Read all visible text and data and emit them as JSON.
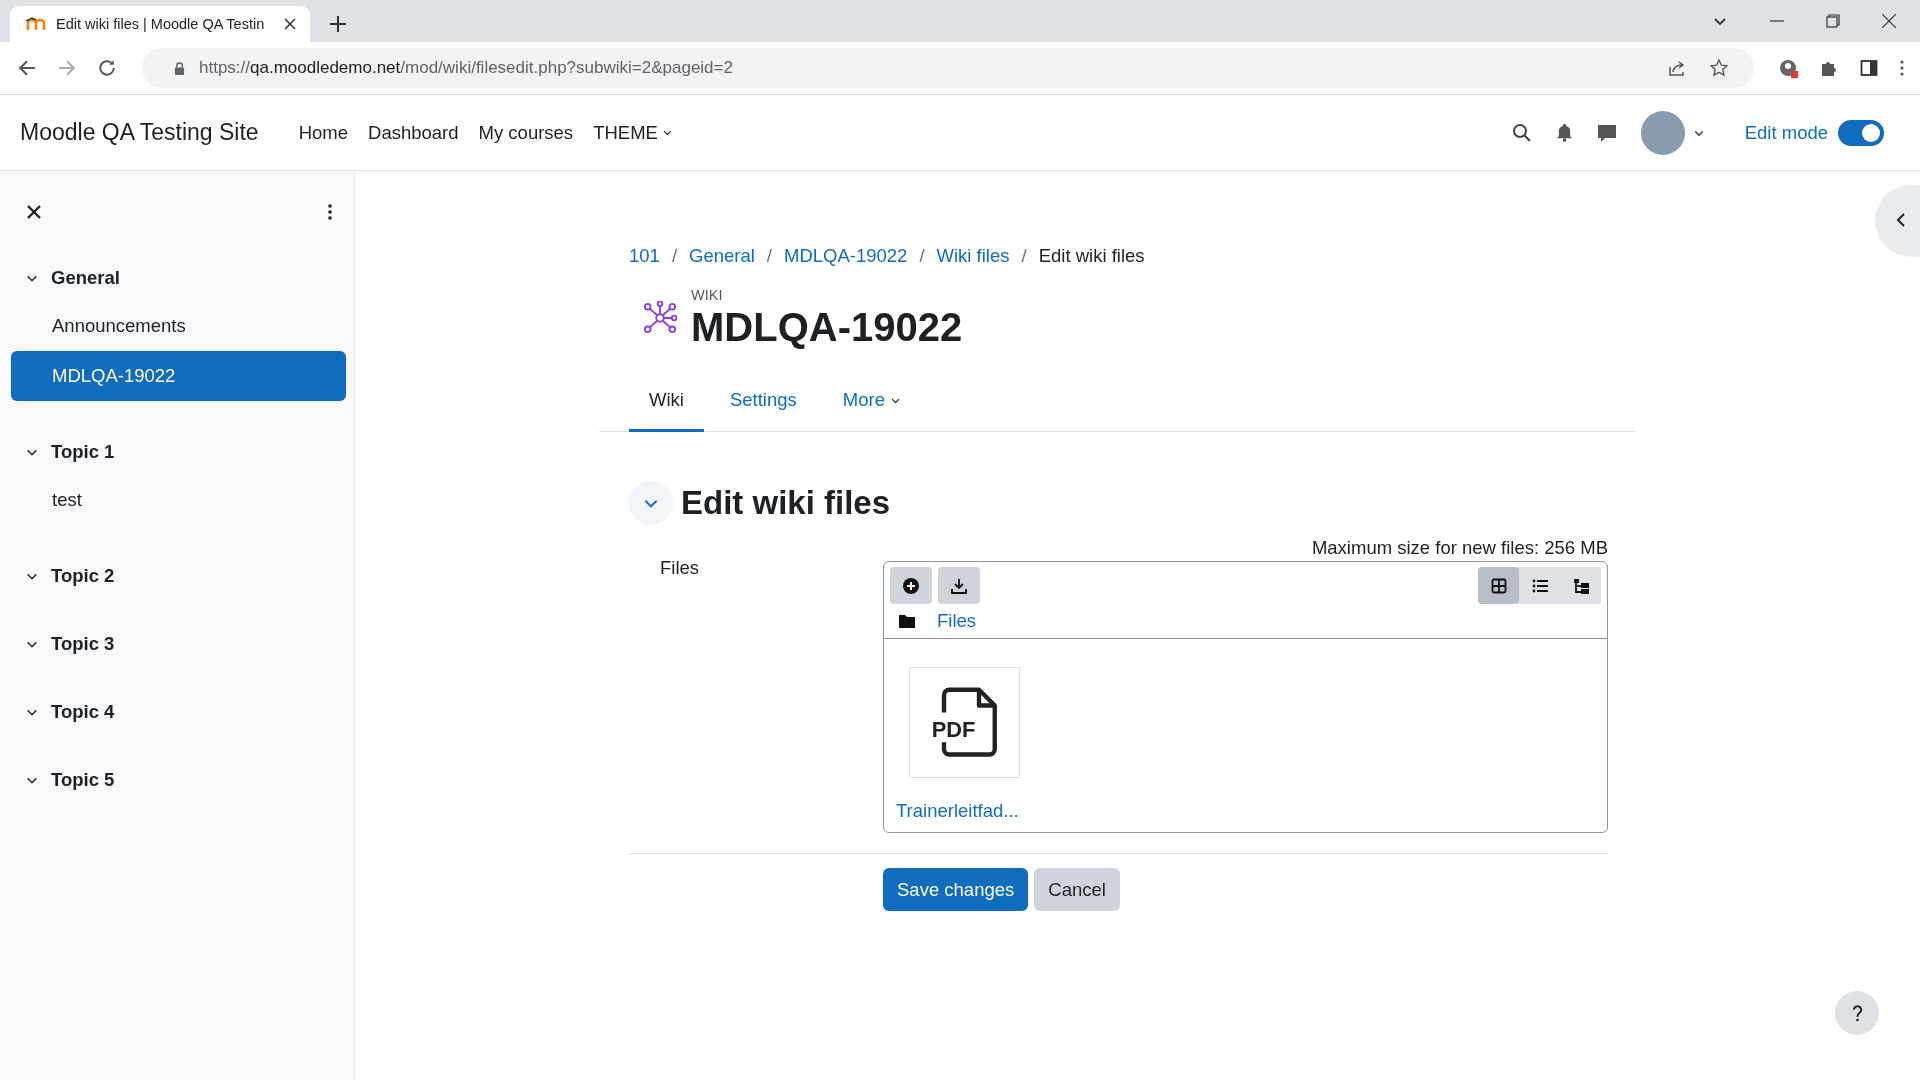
{
  "browser": {
    "tab_title": "Edit wiki files | Moodle QA Testin",
    "url_scheme": "https://",
    "url_host": "qa.moodledemo.net",
    "url_path": "/mod/wiki/filesedit.php?subwiki=2&pageid=2"
  },
  "navbar": {
    "site_name": "Moodle QA Testing Site",
    "links": [
      {
        "label": "Home",
        "dropdown": false
      },
      {
        "label": "Dashboard",
        "dropdown": false
      },
      {
        "label": "My courses",
        "dropdown": false
      },
      {
        "label": "THEME",
        "dropdown": true
      }
    ],
    "edit_mode": {
      "label": "Edit mode",
      "on": true
    }
  },
  "sidebar": {
    "sections": [
      {
        "label": "General",
        "expanded": true,
        "children": [
          {
            "label": "Announcements",
            "selected": false
          },
          {
            "label": "MDLQA-19022",
            "selected": true
          }
        ]
      },
      {
        "label": "Topic 1",
        "expanded": true,
        "children": [
          {
            "label": "test",
            "selected": false
          }
        ]
      },
      {
        "label": "Topic 2",
        "expanded": true
      },
      {
        "label": "Topic 3",
        "expanded": true
      },
      {
        "label": "Topic 4",
        "expanded": true
      },
      {
        "label": "Topic 5",
        "expanded": true
      }
    ]
  },
  "breadcrumb": {
    "separator": "/",
    "items": [
      {
        "label": "101",
        "kind": "link"
      },
      {
        "label": "General",
        "kind": "link"
      },
      {
        "label": "MDLQA-19022",
        "kind": "link"
      },
      {
        "label": "Wiki files",
        "kind": "link"
      },
      {
        "label": "Edit wiki files",
        "kind": "text"
      }
    ]
  },
  "activity": {
    "type_label": "WIKI",
    "title": "MDLQA-19022"
  },
  "tabs": [
    {
      "label": "Wiki",
      "selected": true,
      "dropdown": false
    },
    {
      "label": "Settings",
      "selected": false,
      "dropdown": false
    },
    {
      "label": "More",
      "selected": false,
      "dropdown": true
    }
  ],
  "section": {
    "title": "Edit wiki files",
    "expanded": true
  },
  "form": {
    "field_label": "Files",
    "max_size": "Maximum size for new files: 256 MB",
    "path": "Files",
    "view_modes": [
      {
        "kind": "icons",
        "selected": true
      },
      {
        "kind": "list",
        "selected": false
      },
      {
        "kind": "tree",
        "selected": false
      }
    ],
    "files": [
      {
        "name": "Trainerleitfad...",
        "icon_label": "PDF"
      }
    ],
    "buttons": [
      {
        "label": "Save changes",
        "kind": "primary"
      },
      {
        "label": "Cancel",
        "kind": "secondary"
      }
    ]
  }
}
